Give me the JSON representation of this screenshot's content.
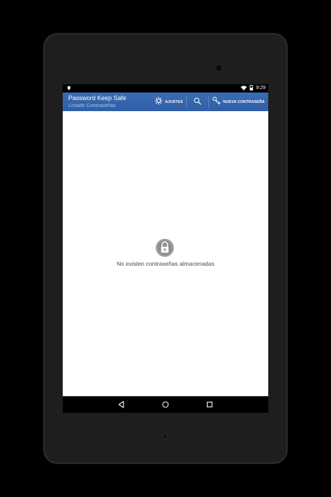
{
  "status_bar": {
    "time": "9:29",
    "icons": [
      "notification-icon",
      "wifi-icon",
      "battery-icon"
    ]
  },
  "action_bar": {
    "title": "Password Keep Safe",
    "subtitle": "Listado Contraseñas",
    "background_color": "#2f5ea5",
    "actions": {
      "settings_label": "AJUSTES",
      "search_icon": "search-icon",
      "new_password_label": "NUEVA CONTRASEÑA"
    }
  },
  "content": {
    "empty_icon": "lock-icon",
    "empty_message": "No existen contraseñas almacenadas"
  },
  "nav_bar": {
    "icons": [
      "back-icon",
      "home-icon",
      "recents-icon"
    ]
  }
}
